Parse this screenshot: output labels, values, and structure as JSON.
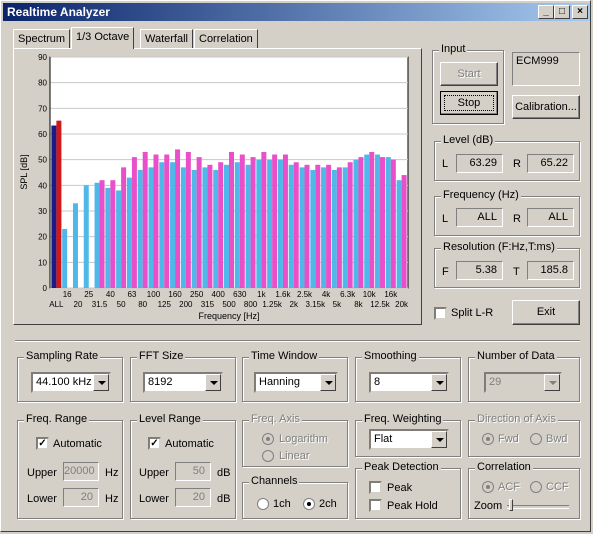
{
  "window": {
    "title": "Realtime Analyzer",
    "min_label": "_",
    "max_label": "□",
    "close_label": "×"
  },
  "tabs": [
    "Spectrum",
    "1/3 Octave",
    "Waterfall",
    "Correlation"
  ],
  "input": {
    "group_label": "Input",
    "start_label": "Start",
    "stop_label": "Stop",
    "device": "ECM999",
    "calibration_label": "Calibration..."
  },
  "level": {
    "group_label": "Level (dB)",
    "l_label": "L",
    "l_value": "63.29",
    "r_label": "R",
    "r_value": "65.22"
  },
  "frequency": {
    "group_label": "Frequency (Hz)",
    "l_label": "L",
    "l_value": "ALL",
    "r_label": "R",
    "r_value": "ALL"
  },
  "resolution": {
    "group_label": "Resolution (F:Hz,T:ms)",
    "f_label": "F",
    "f_value": "5.38",
    "t_label": "T",
    "t_value": "185.8"
  },
  "split": {
    "label": "Split L-R",
    "checked": false
  },
  "exit_label": "Exit",
  "sampling_rate": {
    "group_label": "Sampling Rate",
    "value": "44.100 kHz"
  },
  "fft_size": {
    "group_label": "FFT Size",
    "value": "8192"
  },
  "time_window": {
    "group_label": "Time Window",
    "value": "Hanning"
  },
  "smoothing": {
    "group_label": "Smoothing",
    "value": "8"
  },
  "number_of_data": {
    "group_label": "Number of Data",
    "value": "29"
  },
  "freq_range": {
    "group_label": "Freq. Range",
    "automatic_label": "Automatic",
    "automatic": true,
    "upper_label": "Upper",
    "upper_value": "20000",
    "upper_unit": "Hz",
    "lower_label": "Lower",
    "lower_value": "20",
    "lower_unit": "Hz"
  },
  "level_range": {
    "group_label": "Level Range",
    "automatic_label": "Automatic",
    "automatic": true,
    "upper_label": "Upper",
    "upper_value": "50",
    "upper_unit": "dB",
    "lower_label": "Lower",
    "lower_value": "20",
    "lower_unit": "dB"
  },
  "freq_axis": {
    "group_label": "Freq. Axis",
    "logarithm_label": "Logarithm",
    "linear_label": "Linear",
    "selected": "Logarithm"
  },
  "freq_weighting": {
    "group_label": "Freq. Weighting",
    "value": "Flat"
  },
  "direction_of_axis": {
    "group_label": "Direction of Axis",
    "fwd_label": "Fwd",
    "bwd_label": "Bwd",
    "selected": "Fwd"
  },
  "channels": {
    "group_label": "Channels",
    "ch1_label": "1ch",
    "ch2_label": "2ch",
    "selected": "2ch"
  },
  "peak_detection": {
    "group_label": "Peak Detection",
    "peak_label": "Peak",
    "peak_hold_label": "Peak Hold"
  },
  "correlation": {
    "group_label": "Correlation",
    "acf_label": "ACF",
    "ccf_label": "CCF",
    "selected": "ACF",
    "zoom_label": "Zoom"
  },
  "colors": {
    "series_l": "#4fb8e8",
    "series_r": "#e84fc8",
    "all_l": "#1a1a8a",
    "all_r": "#d01818",
    "plot_bg": "#ffffff"
  },
  "chart_data": {
    "type": "bar",
    "ylabel": "SPL [dB]",
    "xlabel": "Frequency [Hz]",
    "ylim": [
      0,
      90
    ],
    "yticks": [
      0,
      10,
      20,
      30,
      40,
      50,
      60,
      70,
      80,
      90
    ],
    "categories": [
      "ALL",
      "16",
      "20",
      "25",
      "31.5",
      "40",
      "50",
      "63",
      "80",
      "100",
      "125",
      "160",
      "200",
      "250",
      "315",
      "400",
      "500",
      "630",
      "800",
      "1k",
      "1.25k",
      "1.6k",
      "2k",
      "2.5k",
      "3.15k",
      "4k",
      "5k",
      "6.3k",
      "8k",
      "10k",
      "12.5k",
      "16k",
      "20k"
    ],
    "series": [
      {
        "values": [
          63.3,
          23,
          33,
          40,
          41,
          39,
          38,
          43,
          46,
          47,
          49,
          49,
          47,
          46,
          47,
          46,
          48,
          49,
          48,
          50,
          50,
          50,
          48,
          47,
          46,
          47,
          46,
          47,
          50,
          52,
          52,
          51,
          42
        ]
      },
      {
        "values": [
          65.2,
          null,
          null,
          null,
          42,
          42,
          47,
          51,
          53,
          52,
          52,
          54,
          53,
          51,
          48,
          49,
          53,
          52,
          51,
          53,
          52,
          52,
          49,
          48,
          48,
          48,
          47,
          49,
          51,
          53,
          51,
          50,
          44
        ]
      }
    ]
  }
}
